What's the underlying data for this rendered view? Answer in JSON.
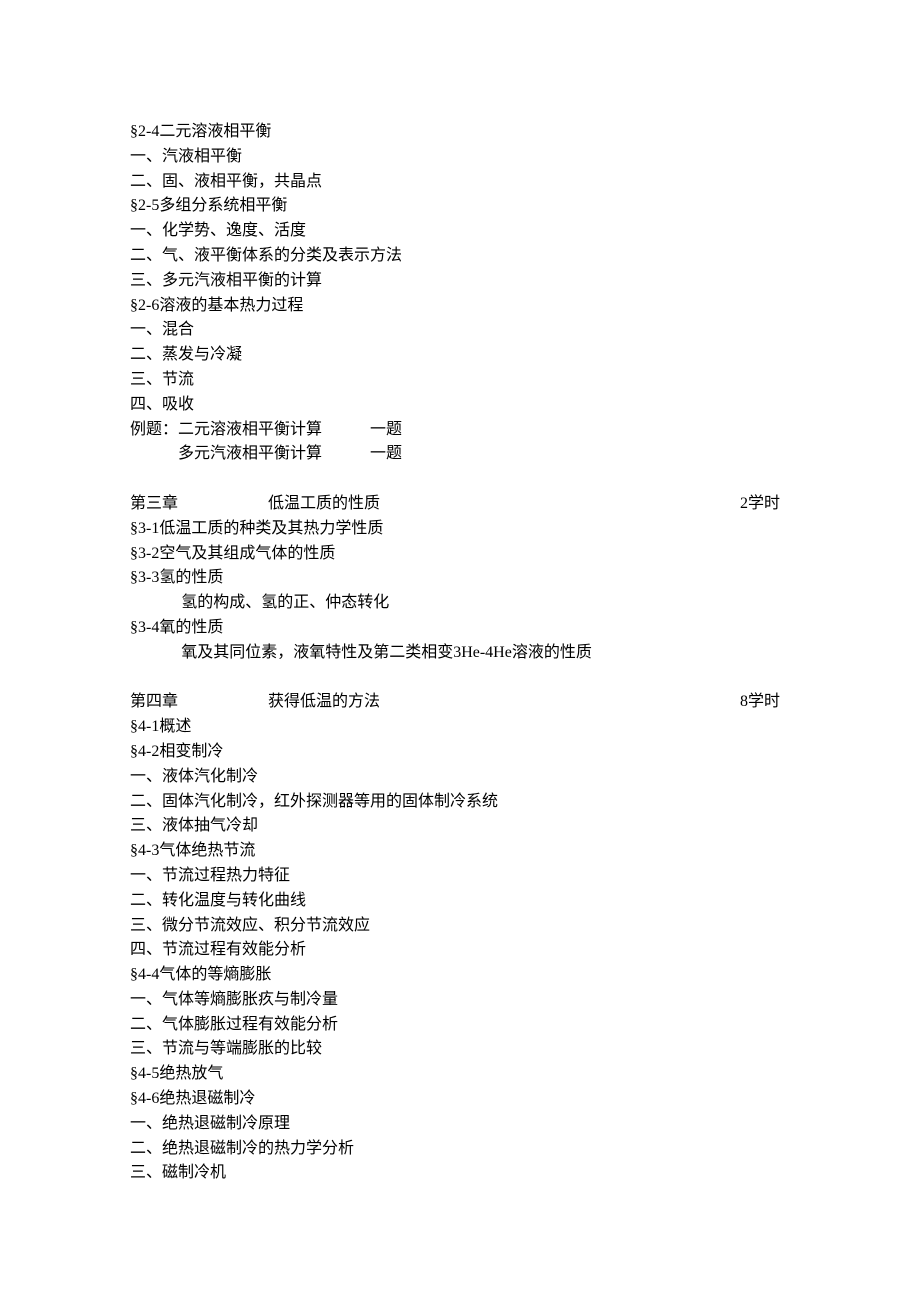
{
  "section_2_4": {
    "heading": "§2-4二元溶液相平衡",
    "items": [
      "一、汽液相平衡",
      "二、固、液相平衡，共晶点"
    ]
  },
  "section_2_5": {
    "heading": "§2-5多组分系统相平衡",
    "items": [
      "一、化学势、逸度、活度",
      "二、气、液平衡体系的分类及表示方法",
      "三、多元汽液相平衡的计算"
    ]
  },
  "section_2_6": {
    "heading": "§2-6溶液的基本热力过程",
    "items": [
      "一、混合",
      "二、蒸发与冷凝",
      "三、节流",
      "四、吸收"
    ]
  },
  "examples": {
    "prefix": "例题：",
    "rows": [
      {
        "text": "二元溶液相平衡计算",
        "count": "一题"
      },
      {
        "text": "多元汽液相平衡计算",
        "count": "一题"
      }
    ]
  },
  "chapter3": {
    "label": "第三章",
    "title": "低温工质的性质",
    "hours": "2学时",
    "sections": [
      {
        "heading": "§3-1低温工质的种类及其热力学性质",
        "lines": []
      },
      {
        "heading": "§3-2空气及其组成气体的性质",
        "lines": []
      },
      {
        "heading": "§3-3氢的性质",
        "lines": [
          "氢的构成、氢的正、仲态转化"
        ]
      },
      {
        "heading": "§3-4氧的性质",
        "lines": [
          "氧及其同位素，液氧特性及第二类相变3He-4He溶液的性质"
        ]
      }
    ]
  },
  "chapter4": {
    "label": "第四章",
    "title": "获得低温的方法",
    "hours": "8学时",
    "sections": [
      {
        "heading": "§4-1概述",
        "lines": []
      },
      {
        "heading": "§4-2相变制冷",
        "lines": [
          "一、液体汽化制冷",
          "二、固体汽化制冷，红外探测器等用的固体制冷系统",
          "三、液体抽气冷却"
        ]
      },
      {
        "heading": "§4-3气体绝热节流",
        "lines": [
          "一、节流过程热力特征",
          "二、转化温度与转化曲线",
          "三、微分节流效应、积分节流效应",
          "四、节流过程有效能分析"
        ]
      },
      {
        "heading": "§4-4气体的等熵膨胀",
        "lines": [
          "一、气体等熵膨胀疚与制冷量",
          "二、气体膨胀过程有效能分析",
          "三、节流与等端膨胀的比较"
        ]
      },
      {
        "heading": "§4-5绝热放气",
        "lines": []
      },
      {
        "heading": "§4-6绝热退磁制冷",
        "lines": [
          "一、绝热退磁制冷原理",
          "二、绝热退磁制冷的热力学分析",
          "三、磁制冷机"
        ]
      }
    ]
  }
}
